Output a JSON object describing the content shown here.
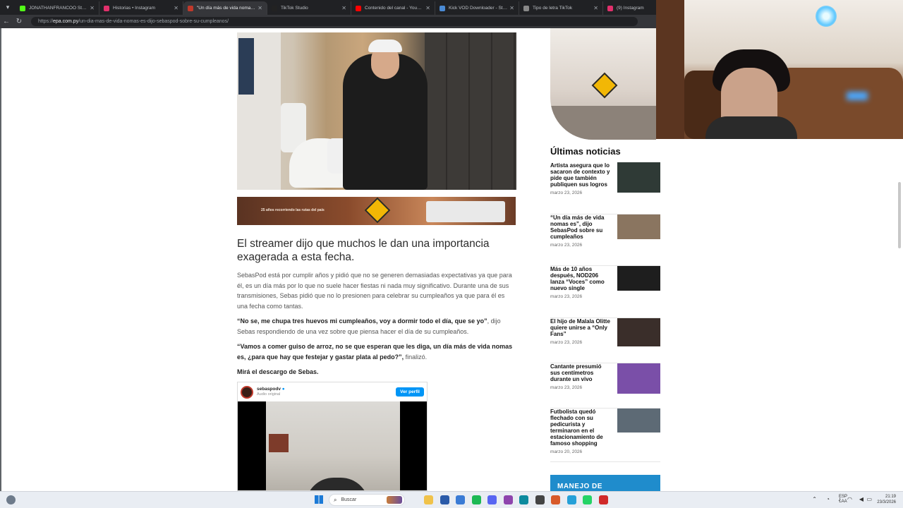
{
  "browser": {
    "tabs": [
      {
        "label": "JONATHANFRANCOO Stream - Wi...",
        "favicon_color": "#53fc18",
        "active": false
      },
      {
        "label": "Historias • Instagram",
        "favicon_color": "#e1306c",
        "active": false
      },
      {
        "label": "\"Un día más de vida nomas es\", dij...",
        "favicon_color": "#c0392b",
        "active": true
      },
      {
        "label": "TikTok Studio",
        "favicon_color": "#222222",
        "active": false
      },
      {
        "label": "Contenido del canal - YouTube St...",
        "favicon_color": "#ff0000",
        "active": false
      },
      {
        "label": "Kick VOD Downloader - Stream...",
        "favicon_color": "#4a8ad4",
        "active": false
      },
      {
        "label": "Tipo de letra TikTok",
        "favicon_color": "#888888",
        "active": false
      },
      {
        "label": "(9) Instagram",
        "favicon_color": "#e1306c",
        "active": false
      }
    ],
    "url_prefix": "https://",
    "url_host": "epa.com.py",
    "url_path": "/un-dia-mas-de-vida-nomas-es-dijo-sebaspod-sobre-su-cumpleanos/"
  },
  "article": {
    "ad_text": "25 años recorriendo las rutas del país",
    "subtitle": "El streamer dijo que muchos le dan una importancia exagerada a esta fecha.",
    "p1": "SebasPod está por cumplir años y pidió que no se generen demasiadas expectativas ya que para él, es un día más por lo que no suele hacer fiestas ni nada muy significativo. Durante una de sus transmisiones, Sebas pidió que no lo presionen para celebrar su cumpleaños ya que para él es una fecha como tantas.",
    "p2_quote": "“No se, me chupa tres huevos mi cumpleaños, voy a dormir todo el día, que se yo”",
    "p2_rest": ", dijo Sebas respondiendo de una vez sobre que piensa hacer el día de su cumpleaños.",
    "p3_quote": "“Vamos a comer guiso de arroz, no se que esperan que les diga, un día más de vida nomas es, ¿para que hay que festejar y gastar plata al pedo?”,",
    "p3_rest": " finalizó.",
    "p4": "Mirá el descargo de Sebas.",
    "embed": {
      "username": "sebaspodv",
      "subtitle": "Audio original",
      "button": "Ver perfil"
    }
  },
  "sidebar": {
    "heading": "Últimas noticias",
    "news": [
      {
        "title": "Artista asegura que lo sacaron de contexto y pide que también publiquen sus logros",
        "date": "marzo 23, 2026",
        "thumb_color": "#2f3a36"
      },
      {
        "title": "“Un día más de vida nomas es”, dijo SebasPod sobre su cumpleaños",
        "date": "marzo 23, 2026",
        "thumb_color": "#8a7560"
      },
      {
        "title": "Más de 10 años después, NOD206 lanza “Voces” como nuevo single",
        "date": "marzo 23, 2026",
        "thumb_color": "#1e1e1e"
      },
      {
        "title": "El hijo de Malala Olitte quiere unirse a “Only Fans”",
        "date": "marzo 23, 2026",
        "thumb_color": "#3a2e2a"
      },
      {
        "title": "Cantante presumió sus centímetros durante un vivo",
        "date": "marzo 23, 2026",
        "thumb_color": "#7a4fa8"
      },
      {
        "title": "Futbolista quedó flechado con su pedicurista y terminaron en el estacionamiento de famoso shopping",
        "date": "marzo 20, 2026",
        "thumb_color": "#5d6a75"
      }
    ],
    "bottom_ad": "MANEJO DE"
  },
  "taskbar": {
    "search_placeholder": "Buscar",
    "lang_top": "ESP",
    "lang_bottom": "LAA",
    "time": "21:19",
    "date": "23/3/2026",
    "apps": [
      {
        "name": "file-explorer-icon",
        "color": "#f0c24a"
      },
      {
        "name": "app-icon-2",
        "color": "#2a5aa8"
      },
      {
        "name": "app-icon-3",
        "color": "#3a7bd5"
      },
      {
        "name": "spotify-icon",
        "color": "#1db954"
      },
      {
        "name": "discord-icon",
        "color": "#5865f2"
      },
      {
        "name": "app-icon-6",
        "color": "#8e44ad"
      },
      {
        "name": "edge-icon",
        "color": "#0c8a9e"
      },
      {
        "name": "app-icon-8",
        "color": "#444444"
      },
      {
        "name": "app-icon-9",
        "color": "#d85a2a"
      },
      {
        "name": "app-icon-10",
        "color": "#25a0d8"
      },
      {
        "name": "whatsapp-icon",
        "color": "#25d366"
      },
      {
        "name": "app-icon-12",
        "color": "#d02a2a"
      }
    ]
  }
}
